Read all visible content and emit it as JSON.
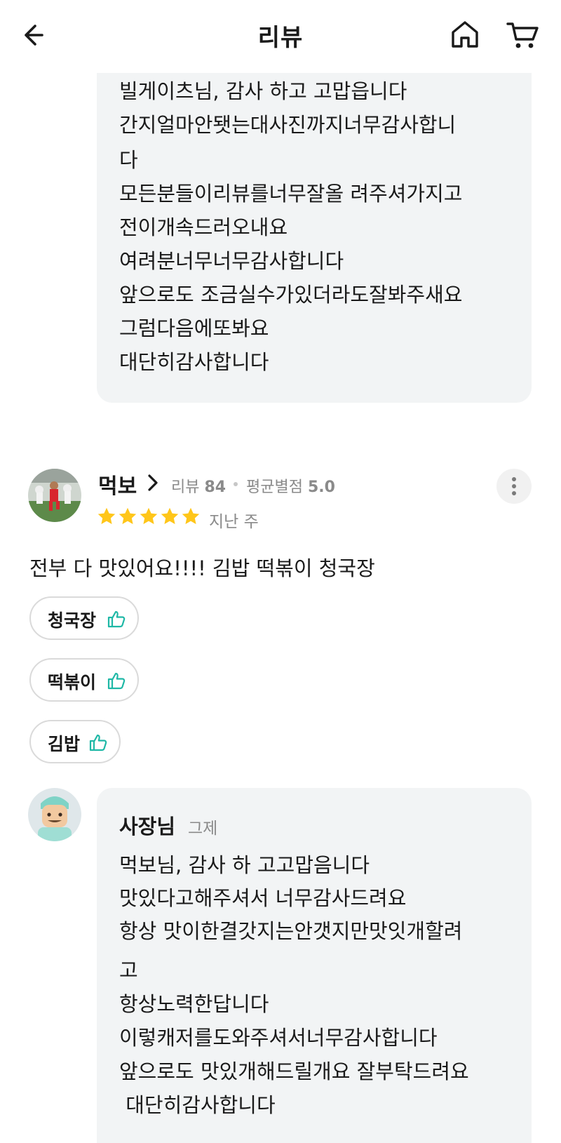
{
  "header": {
    "title": "리뷰",
    "back_icon": "arrow-left-icon",
    "home_icon": "home-icon",
    "cart_icon": "cart-icon"
  },
  "previous_reply": {
    "lines": [
      "빌게이츠님, 감사 하고 고맙읍니다",
      "간지얼마안됏는대사진까지너무감사합니",
      "다",
      "모든분들이리뷰를너무잘올 려주셔가지고",
      "전이개속드러오내요",
      "여려분너무너무감사합니다",
      "앞으로도 조금실수가있더라도잘봐주새요",
      "그럼다음에또봐요",
      "대단히감사합니다"
    ]
  },
  "review": {
    "reviewer_name": "먹보",
    "review_count_label": "리뷰",
    "review_count": "84",
    "avg_rating_label": "평균별점",
    "avg_rating": "5.0",
    "rating_stars": 5,
    "date": "지난 주",
    "text": "전부 다 맛있어요!!!! 김밥 떡볶이 청국장",
    "menu_tags": [
      "청국장",
      "떡볶이",
      "김밥"
    ]
  },
  "owner_reply": {
    "name": "사장님",
    "date": "그제",
    "lines": [
      "먹보님, 감사 하 고고맙음니다",
      "맛있다고해주셔서 너무감사드려요",
      "항상 맛이한결갓지는안갯지만맛잇개할려",
      "고",
      "항상노력한답니다",
      "이렇캐저를도와주셔서너무감사합니다",
      "앞으로도 맛있개해드릴개요 잘부탁드려요",
      " 대단히감사합니다"
    ]
  },
  "colors": {
    "bubble_bg": "#f2f4f5",
    "star": "#ffc61a",
    "thumb": "#1fb8a6",
    "muted_text": "#8a8a8a"
  }
}
